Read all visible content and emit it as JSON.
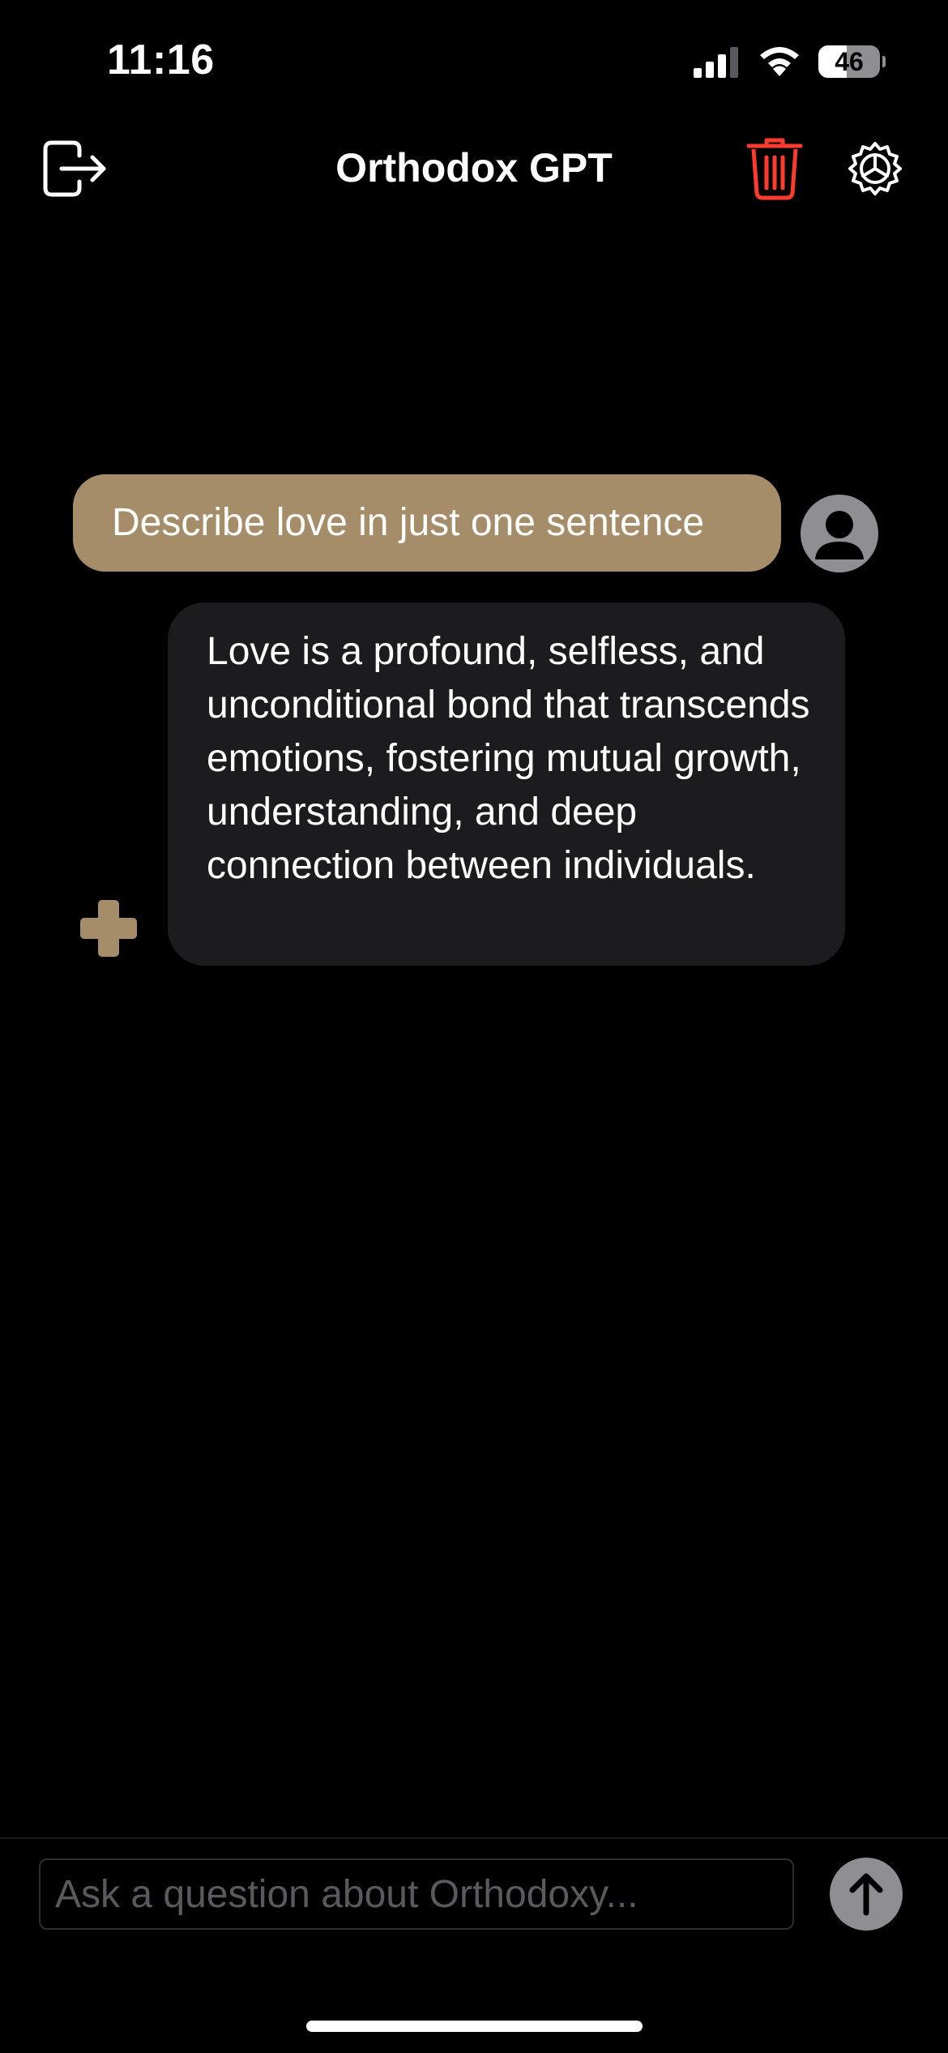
{
  "status_bar": {
    "time": "11:16",
    "battery_level": "46",
    "battery_fraction": 0.46,
    "signal_icon": "cellular-signal-icon",
    "wifi_icon": "wifi-icon",
    "battery_icon": "battery-icon"
  },
  "header": {
    "title": "Orthodox GPT",
    "left_icon": "logout-icon",
    "delete_icon": "trash-icon",
    "settings_icon": "gear-icon",
    "delete_color": "#ff3b30"
  },
  "conversation": {
    "messages": [
      {
        "role": "user",
        "text": "Describe love in just one sentence",
        "avatar_icon": "person-icon"
      },
      {
        "role": "assistant",
        "text": "Love is a profound, selfless, and unconditional bond that transcends emotions, fostering mutual growth, understanding, and deep connection between individuals.",
        "avatar_icon": "cross-icon"
      }
    ]
  },
  "composer": {
    "placeholder": "Ask a question about Orthodoxy...",
    "value": "",
    "send_icon": "arrow-up-icon"
  },
  "colors": {
    "background": "#000000",
    "accent": "#a68d69",
    "assistant_bubble": "#1c1c1e",
    "muted": "#8e8e93"
  }
}
